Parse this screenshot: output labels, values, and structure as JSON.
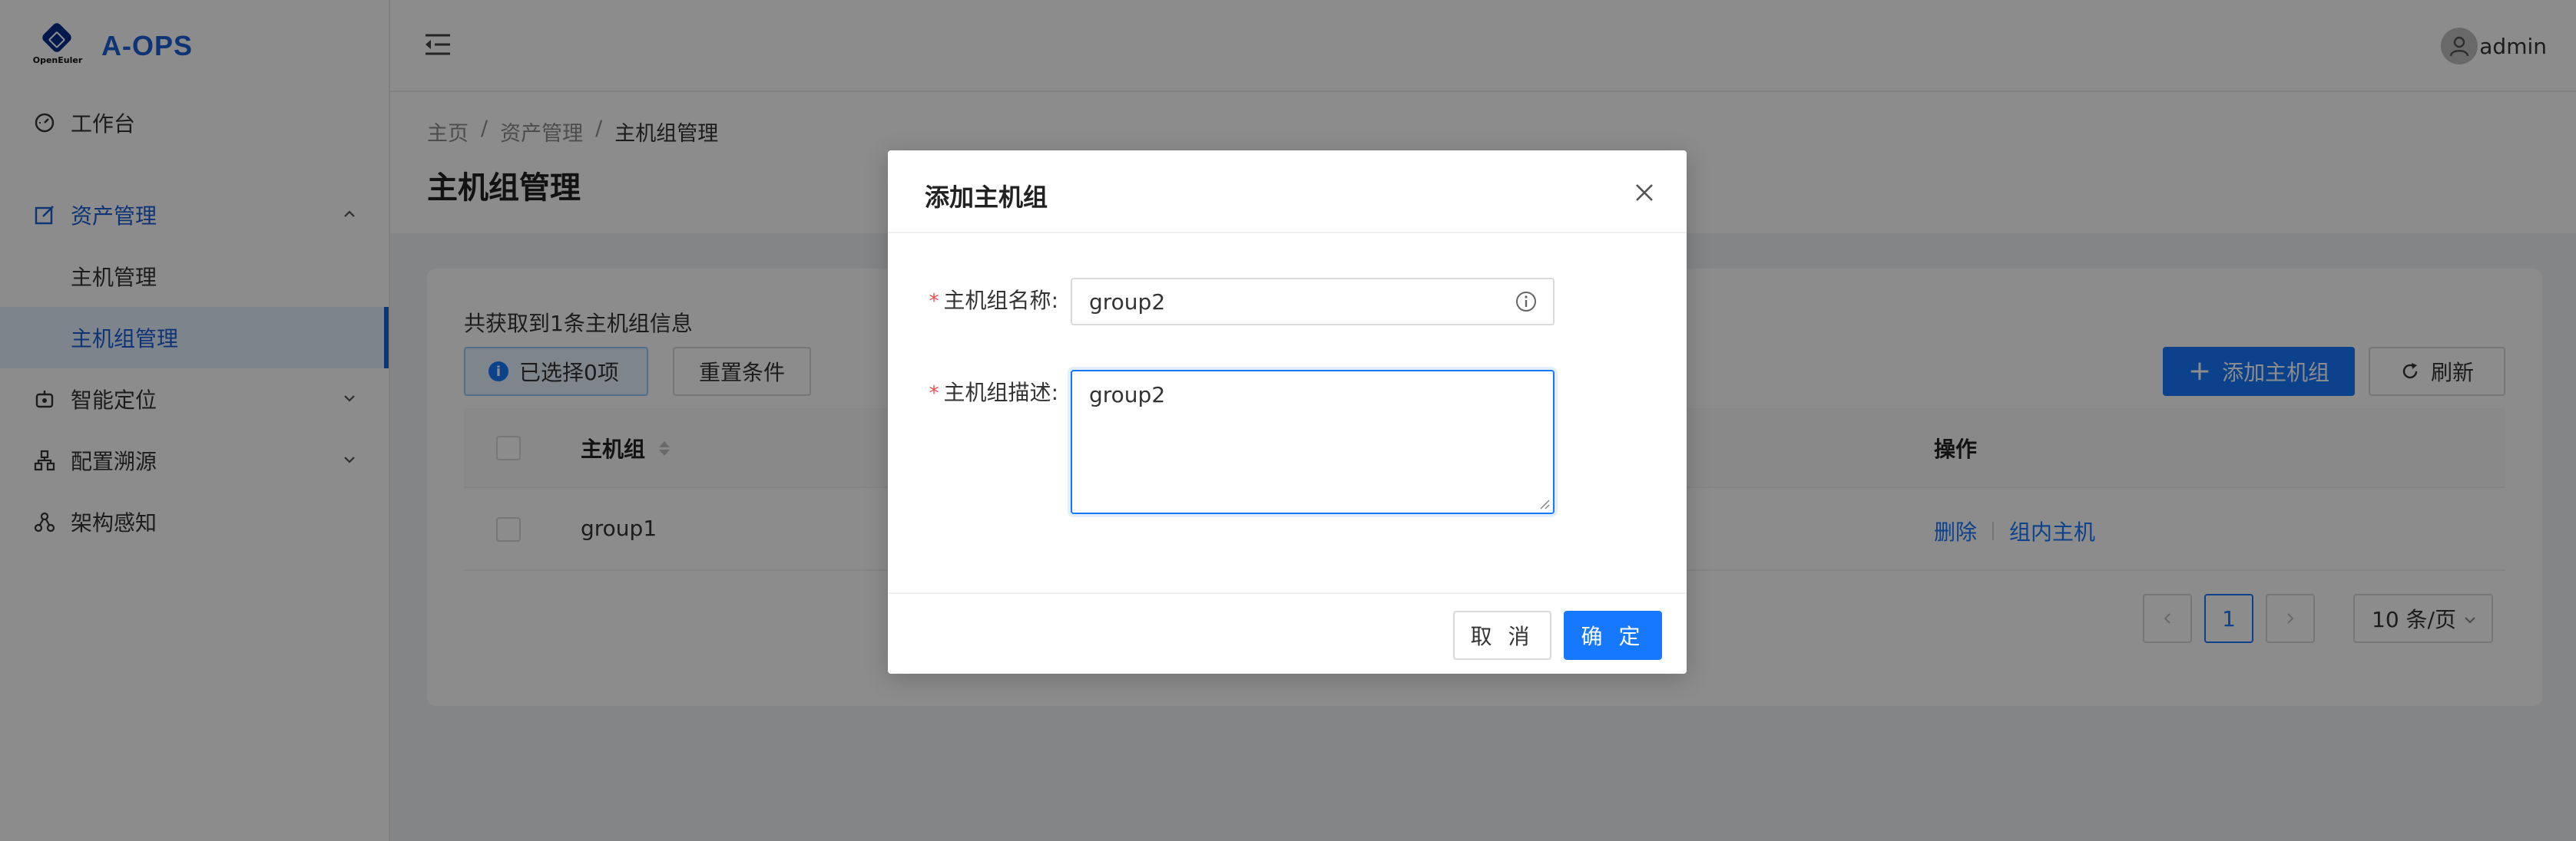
{
  "app": {
    "brand_sub": "OpenEuler",
    "title": "A-OPS"
  },
  "sidebar": {
    "items": [
      {
        "label": "工作台",
        "icon": "dashboard-icon"
      },
      {
        "label": "资产管理",
        "icon": "edit-square-icon",
        "expanded": true,
        "children": [
          {
            "label": "主机管理"
          },
          {
            "label": "主机组管理",
            "active": true
          }
        ]
      },
      {
        "label": "智能定位",
        "icon": "robot-icon"
      },
      {
        "label": "配置溯源",
        "icon": "cluster-icon"
      },
      {
        "label": "架构感知",
        "icon": "share-icon"
      }
    ]
  },
  "header": {
    "user": "admin"
  },
  "breadcrumb": [
    "主页",
    "资产管理",
    "主机组管理"
  ],
  "page": {
    "title": "主机组管理",
    "summary": "共获取到1条主机组信息",
    "selected_label": "已选择0项",
    "reset_label": "重置条件",
    "add_label": "添加主机组",
    "refresh_label": "刷新"
  },
  "table": {
    "columns": [
      "主机组",
      "操作"
    ],
    "rows": [
      {
        "name": "group1",
        "actions": [
          "删除",
          "组内主机"
        ]
      }
    ]
  },
  "pagination": {
    "current": "1",
    "page_size": "10 条/页"
  },
  "modal": {
    "title": "添加主机组",
    "name_label": "主机组名称",
    "name_value": "group2",
    "desc_label": "主机组描述",
    "desc_value": "group2",
    "cancel_label": "取 消",
    "ok_label": "确 定"
  },
  "colors": {
    "primary": "#1677ff",
    "brand": "#1a5fd6",
    "required": "#ff4d4f"
  }
}
